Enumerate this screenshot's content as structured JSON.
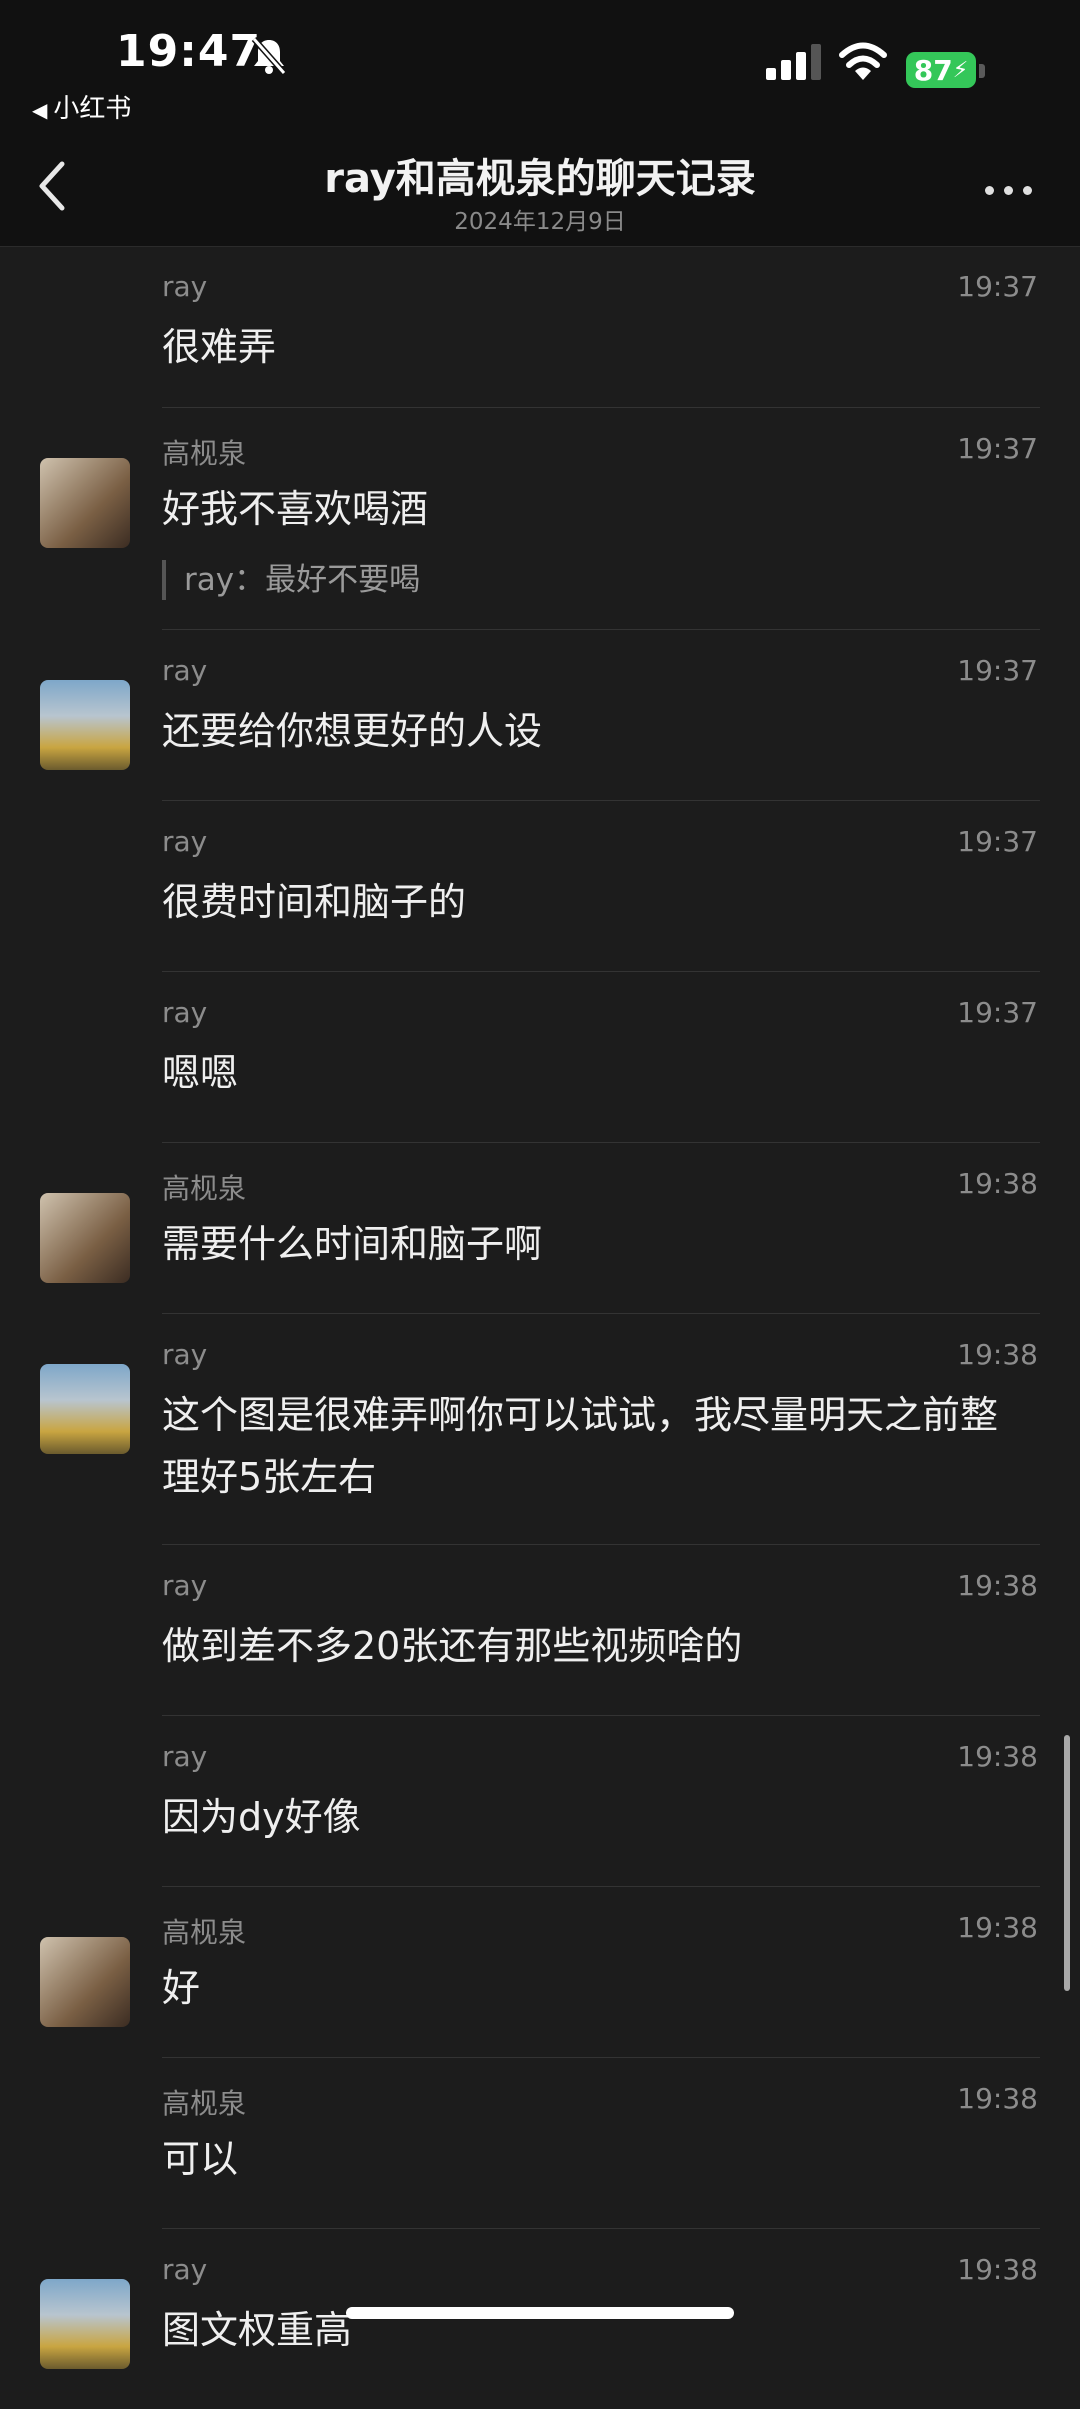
{
  "status": {
    "time": "19:47",
    "back_app": "小红书",
    "battery": "87"
  },
  "nav": {
    "title": "ray和高枧泉的聊天记录",
    "date": "2024年12月9日"
  },
  "messages": [
    {
      "sender": "ray",
      "time": "19:37",
      "text": "很难弄",
      "avatar": ""
    },
    {
      "sender": "高枧泉",
      "time": "19:37",
      "text": "好我不喜欢喝酒",
      "quote": "ray：最好不要喝",
      "avatar": "b"
    },
    {
      "sender": "ray",
      "time": "19:37",
      "text": "还要给你想更好的人设",
      "avatar": "r"
    },
    {
      "sender": "ray",
      "time": "19:37",
      "text": "很费时间和脑子的",
      "avatar": ""
    },
    {
      "sender": "ray",
      "time": "19:37",
      "text": "嗯嗯",
      "avatar": ""
    },
    {
      "sender": "高枧泉",
      "time": "19:38",
      "text": "需要什么时间和脑子啊",
      "avatar": "b"
    },
    {
      "sender": "ray",
      "time": "19:38",
      "text": "这个图是很难弄啊你可以试试，我尽量明天之前整理好5张左右",
      "avatar": "r"
    },
    {
      "sender": "ray",
      "time": "19:38",
      "text": "做到差不多20张还有那些视频啥的",
      "avatar": ""
    },
    {
      "sender": "ray",
      "time": "19:38",
      "text": "因为dy好像",
      "avatar": ""
    },
    {
      "sender": "高枧泉",
      "time": "19:38",
      "text": "好",
      "avatar": "b"
    },
    {
      "sender": "高枧泉",
      "time": "19:38",
      "text": "可以",
      "avatar": ""
    },
    {
      "sender": "ray",
      "time": "19:38",
      "text": "图文权重高",
      "avatar": "r"
    }
  ]
}
